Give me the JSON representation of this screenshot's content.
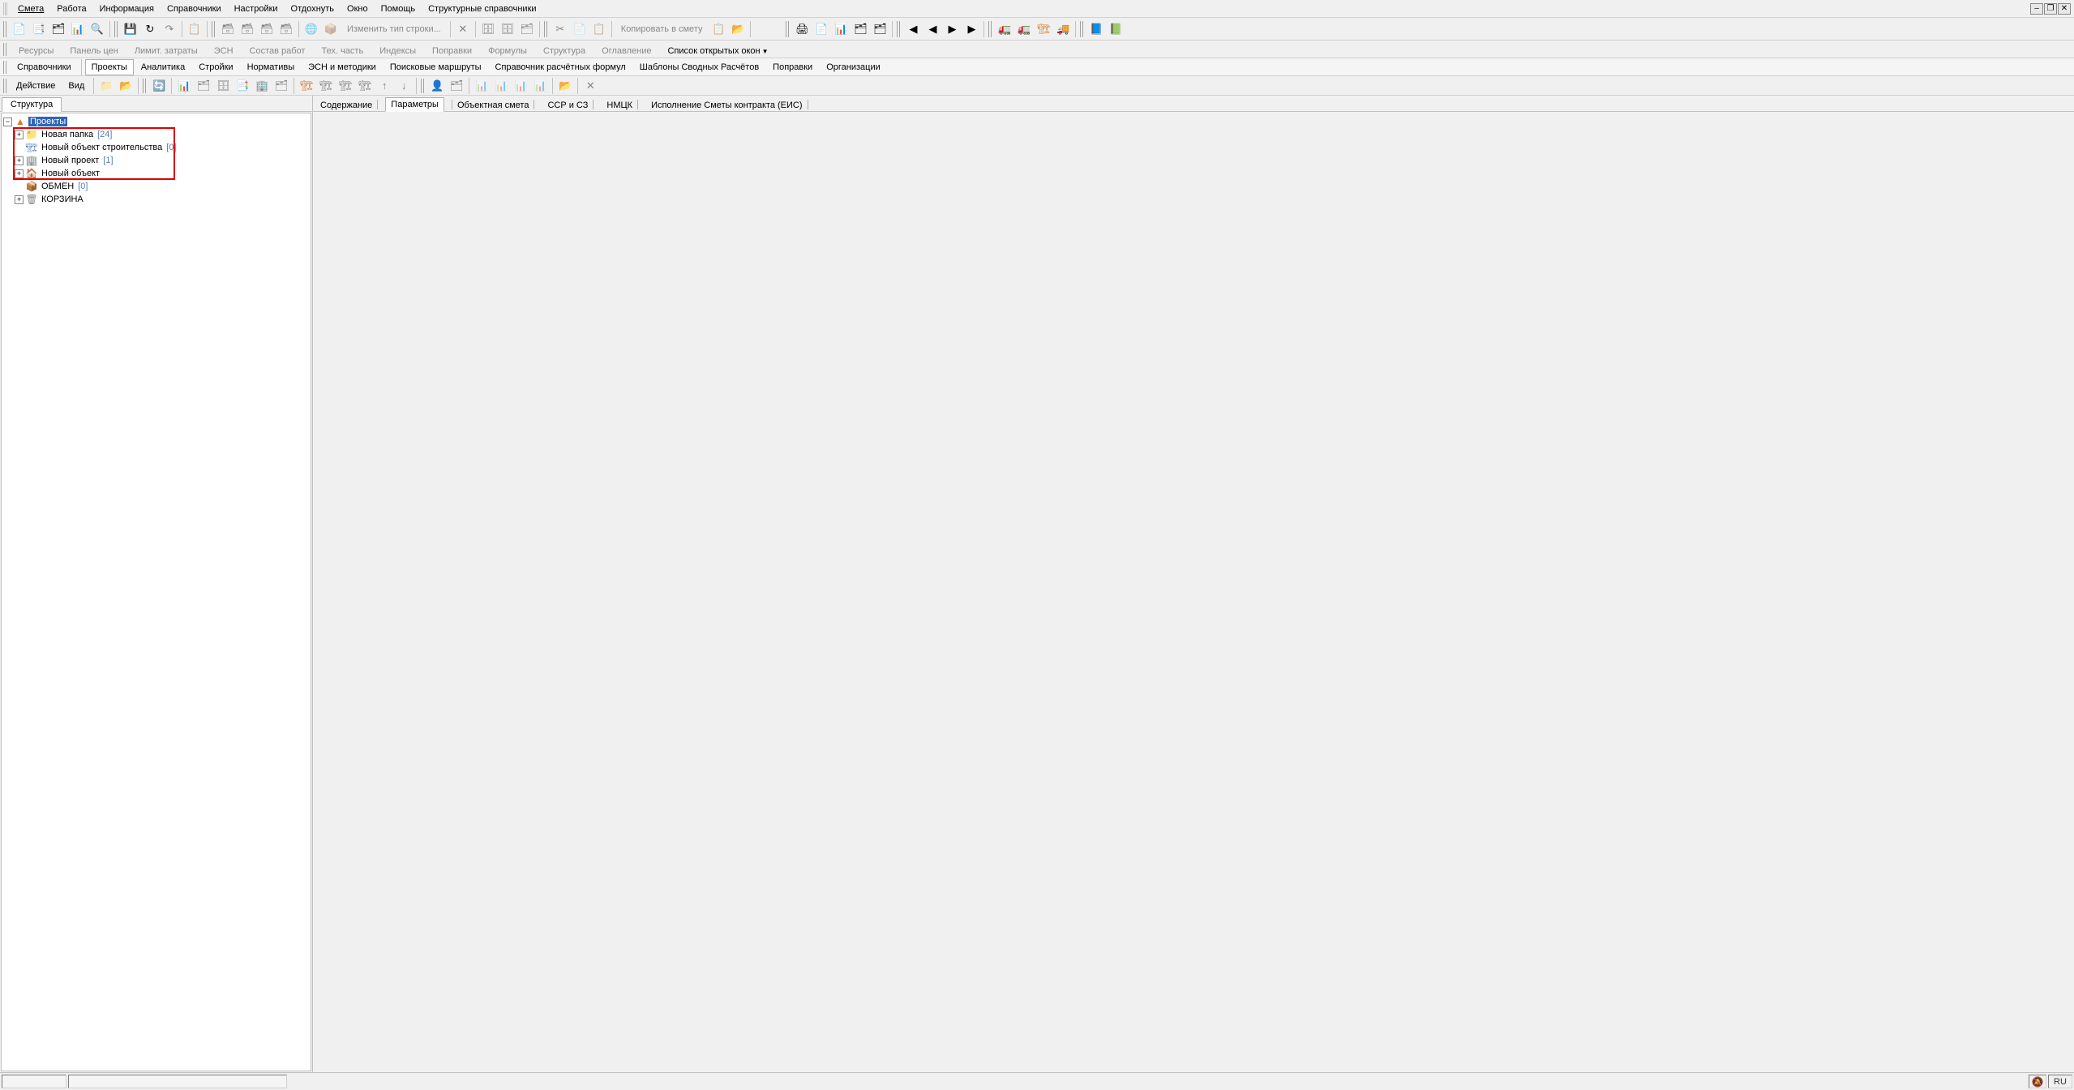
{
  "menu": {
    "items": [
      "Смета",
      "Работа",
      "Информация",
      "Справочники",
      "Настройки",
      "Отдохнуть",
      "Окно",
      "Помощь",
      "Структурные справочники"
    ],
    "underlines": [
      0,
      -1,
      -1,
      -1,
      -1,
      -1,
      -1,
      -1,
      -1
    ]
  },
  "tb1": {
    "group_a_icons": [
      "📄",
      "📑",
      "🗂",
      "📊",
      "🔍"
    ],
    "group_b_icons": [
      "💾",
      "↻",
      "↷"
    ],
    "group_c_icons": [
      "📋"
    ],
    "group_d_icons": [
      "🗃",
      "🗃",
      "🗃",
      "🗃"
    ],
    "group_e_icons": [
      "🌐",
      "📦"
    ],
    "change_type": "Изменить тип строки...",
    "close_icon": "✕",
    "group_f_icons": [
      "🗄",
      "🗄",
      "🗂"
    ],
    "group_g_icons": [
      "✂",
      "📄",
      "📋"
    ],
    "copy_to": "Копировать в смету",
    "group_h_icons": [
      "📋",
      "📂"
    ],
    "group_i_icons": [
      "🖨",
      "📄",
      "📊",
      "🗂",
      "🗂"
    ],
    "group_j_icons": [
      "◀",
      "◀",
      "▶",
      "▶"
    ],
    "group_k_icons": [
      "🚛",
      "🚛",
      "🏗",
      "🚚"
    ],
    "group_l_icons": [
      "📘",
      "📗"
    ]
  },
  "tabs1": [
    "Ресурсы",
    "Панель цен",
    "Лимит. затраты",
    "ЭСН",
    "Состав работ",
    "Тех. часть",
    "Индексы",
    "Поправки",
    "Формулы",
    "Структура",
    "Оглавление",
    "Список открытых окон"
  ],
  "tabs1_enabled": 11,
  "tabs2": [
    "Справочники",
    "Проекты",
    "Аналитика",
    "Стройки",
    "Нормативы",
    "ЭСН и методики",
    "Поисковые маршруты",
    "Справочник расчётных формул",
    "Шаблоны Сводных Расчётов",
    "Поправки",
    "Организации"
  ],
  "tabs2_active": 1,
  "actbar": {
    "action": "Действие",
    "view": "Вид",
    "icons_a": [
      "📁",
      "📂"
    ],
    "icons_b": [
      "🔄"
    ],
    "icons_c": [
      "📊",
      "🗂",
      "🗄",
      "📑",
      "🏢",
      "🗂"
    ],
    "icons_d": [
      "🏗",
      "🏗",
      "🏗",
      "🏗"
    ],
    "icons_e": [
      "↑",
      "↓"
    ],
    "icons_f": [
      "👤",
      "🗂"
    ],
    "icons_g": [
      "📊",
      "📊",
      "📊",
      "📊"
    ],
    "icons_h": [
      "📂"
    ],
    "icons_i": [
      "✕"
    ]
  },
  "panel_tab": "Структура",
  "tree": {
    "root": "Проекты",
    "children": [
      {
        "exp": "+",
        "icon": "📁",
        "color": "#f0c040",
        "label": "Новая папка",
        "count": "[24]",
        "highlight": true
      },
      {
        "exp": "",
        "icon": "🏗",
        "color": "#5080c0",
        "label": "Новый объект строительства",
        "count": "[0]",
        "highlight": true
      },
      {
        "exp": "+",
        "icon": "🏢",
        "color": "#5080c0",
        "label": "Новый проект",
        "count": "[1]",
        "highlight": true
      },
      {
        "exp": "+",
        "icon": "🏠",
        "color": "#c08050",
        "label": "Новый объект",
        "count": "",
        "highlight": true
      },
      {
        "exp": "",
        "icon": "📦",
        "color": "#d0a030",
        "label": "ОБМЕН",
        "count": "[0]",
        "highlight": false
      },
      {
        "exp": "+",
        "icon": "🗑",
        "color": "#888",
        "label": "КОРЗИНА",
        "count": "",
        "highlight": false
      }
    ]
  },
  "rtabs": [
    "Содержание",
    "Параметры",
    "Объектная смета",
    "ССР и СЗ",
    "НМЦК",
    "Исполнение Сметы контракта (ЕИС)"
  ],
  "rtabs_active": 1,
  "status": {
    "lang": "RU",
    "icon": "🔕"
  }
}
